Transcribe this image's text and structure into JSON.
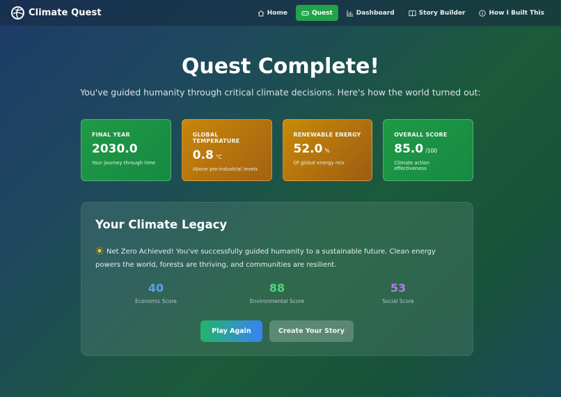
{
  "nav": {
    "brand": "Climate Quest",
    "links": [
      {
        "label": "Home",
        "icon": "home-icon"
      },
      {
        "label": "Quest",
        "icon": "gamepad-icon",
        "active": true
      },
      {
        "label": "Dashboard",
        "icon": "bar-chart-icon"
      },
      {
        "label": "Story Builder",
        "icon": "book-icon"
      },
      {
        "label": "How I Built This",
        "icon": "info-icon"
      }
    ]
  },
  "hero": {
    "title": "Quest Complete!",
    "subtitle": "You've guided humanity through critical climate decisions. Here's how the world turned out:"
  },
  "stats": [
    {
      "label": "FINAL YEAR",
      "value": "2030.0",
      "unit": "",
      "note": "Your journey through time",
      "color": "#1f9a45"
    },
    {
      "label": "GLOBAL TEMPERATURE",
      "value": "0.8",
      "unit": "°C",
      "note": "Above pre-industrial levels",
      "color": "#c8860a"
    },
    {
      "label": "RENEWABLE ENERGY",
      "value": "52.0",
      "unit": "%",
      "note": "Of global energy mix",
      "color": "#c98a07"
    },
    {
      "label": "OVERALL SCORE",
      "value": "85.0",
      "unit": "/100",
      "note": "Climate action effectiveness",
      "color": "#1f9a45"
    }
  ],
  "legacy": {
    "title": "Your Climate Legacy",
    "message": "Net Zero Achieved! You've successfully guided humanity to a sustainable future. Clean energy powers the world, forests are thriving, and communities are resilient.",
    "scores": [
      {
        "value": "40",
        "label": "Economic Score",
        "color": "#5aa0f0"
      },
      {
        "value": "88",
        "label": "Environmental Score",
        "color": "#4fd67a"
      },
      {
        "value": "53",
        "label": "Social Score",
        "color": "#b07fe8"
      }
    ],
    "buttons": {
      "play_again": "Play Again",
      "create_story": "Create Your Story"
    }
  }
}
